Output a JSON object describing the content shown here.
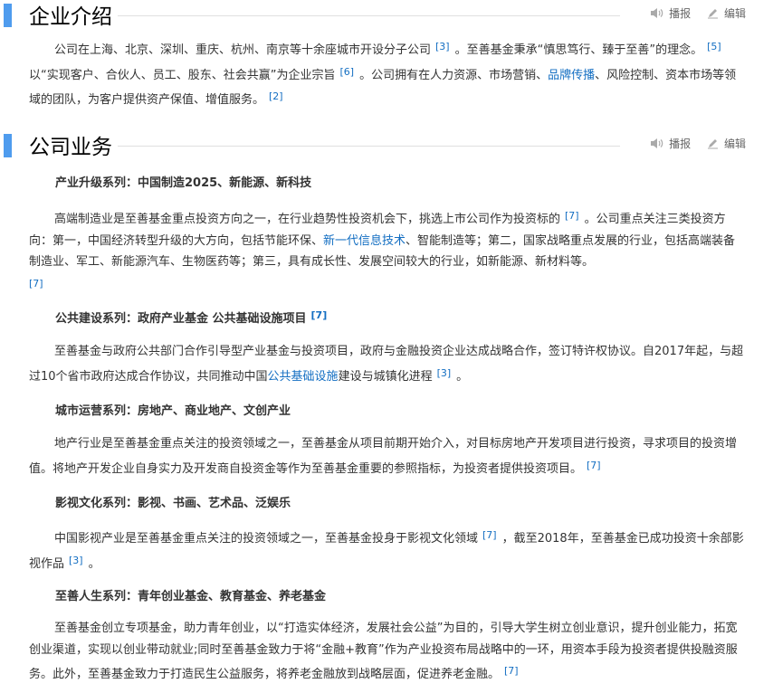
{
  "sections": [
    {
      "title": "企业介绍",
      "actions": {
        "play_label": "播报",
        "edit_label": "编辑"
      },
      "paragraph": {
        "t1": "公司在上海、北京、深圳、重庆、杭州、南京等十余座城市开设分子公司",
        "r1": "[3]",
        "t2": "。至善基金秉承“慎思笃行、臻于至善”的理念。",
        "r2": "[5]",
        "t3": "以“实现客户、合伙人、员工、股东、社会共赢”为企业宗旨",
        "r3": "[6]",
        "t4": "。公司拥有在人力资源、市场营销、",
        "l1": "品牌传播",
        "t5": "、风险控制、资本市场等领域的团队，为客户提供资产保值、增值服务。",
        "r4": "[2]"
      }
    },
    {
      "title": "公司业务",
      "actions": {
        "play_label": "播报",
        "edit_label": "编辑"
      },
      "series": [
        {
          "heading": "产业升级系列：中国制造2025、新能源、新科技",
          "heading_ref": "",
          "t1": "高端制造业是至善基金重点投资方向之一，在行业趋势性投资机会下，挑选上市公司作为投资标的",
          "r1": "[7]",
          "t2": "。公司重点关注三类投资方向：第一，中国经济转型升级的大方向，包括节能环保、",
          "l1": "新一代信息技术",
          "t3": "、智能制造等；第二，国家战略重点发展的行业，包括高端装备制造业、军工、新能源汽车、生物医药等；第三，具有成长性、发展空间较大的行业，如新能源、新材料等。",
          "r2": "[7]"
        },
        {
          "heading": "公共建设系列：政府产业基金 公共基础设施项目",
          "heading_ref": "[7]",
          "t1": "至善基金与政府公共部门合作引导型产业基金与投资项目，政府与金融投资企业达成战略合作，签订特许权协议。自2017年起，与超过10个省市政府达成合作协议，共同推动中国",
          "l1": "公共基础设施",
          "t2": "建设与城镇化进程",
          "r1": "[3]",
          "t3": "。"
        },
        {
          "heading": "城市运营系列：房地产、商业地产、文创产业",
          "t1": "地产行业是至善基金重点关注的投资领域之一，至善基金从项目前期开始介入，对目标房地产开发项目进行投资，寻求项目的投资增值。将地产开发企业自身实力及开发商自投资金等作为至善基金重要的参照指标，为投资者提供投资项目。",
          "r1": "[7]"
        },
        {
          "heading": "影视文化系列：影视、书画、艺术品、泛娱乐",
          "t1": "中国影视产业是至善基金重点关注的投资领域之一，至善基金投身于影视文化领域",
          "r1": "[7]",
          "t2": "，截至2018年，至善基金已成功投资十余部影视作品",
          "r2": "[3]",
          "t3": "。"
        },
        {
          "heading": "至善人生系列：青年创业基金、教育基金、养老基金",
          "t1": "至善基金创立专项基金，助力青年创业，以“打造实体经济，发展社会公益”为目的，引导大学生树立创业意识，提升创业能力，拓宽创业渠道，实现以创业带动就业;同时至善基金致力于将“金融+教育”作为产业投资布局战略中的一环，用资本手段为投资者提供投融资服务。此外，至善基金致力于打造民生公益服务，将养老金融放到战略层面，促进养老金融。",
          "r1": "[7]"
        }
      ]
    }
  ]
}
